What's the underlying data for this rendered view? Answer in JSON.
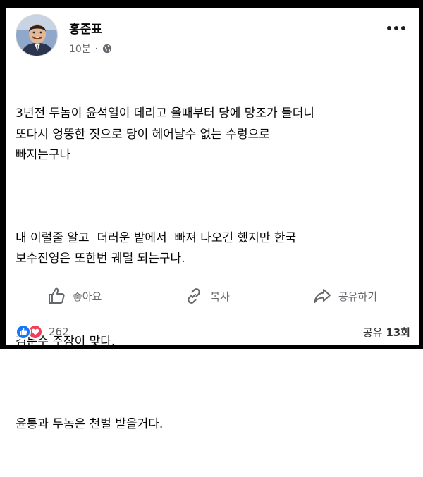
{
  "post": {
    "author": "홍준표",
    "time": "10분",
    "separator": "·",
    "privacy_icon": "globe-icon",
    "more_icon": "more-options-icon",
    "paragraphs": [
      "3년전 두놈이 윤석열이 데리고 올때부터 당에 망조가 들더니\n또다시 엉뚱한 짓으로 당이 헤어날수 없는 수렁으로\n빠지는구나",
      "내 이럴줄 알고  더러운 밭에서  빠져 나오긴 했지만 한국\n보수진영은 또한번 궤멸 되는구나.",
      "김문수 주장이 맞다.",
      "윤통과 두놈은 천벌 받을거다."
    ]
  },
  "actions": {
    "like_label": "좋아요",
    "like_icon": "thumbs-up-icon",
    "copy_label": "복사",
    "copy_icon": "link-icon",
    "share_label": "공유하기",
    "share_icon": "share-arrow-icon"
  },
  "footer": {
    "reaction_icons": [
      "like-reaction-icon",
      "love-reaction-icon"
    ],
    "reaction_count": "262",
    "share_prefix": "공유",
    "share_count": "13회"
  },
  "colors": {
    "like_blue": "#1877f2",
    "love_red": "#f33e58",
    "secondary_text": "#65676b"
  }
}
